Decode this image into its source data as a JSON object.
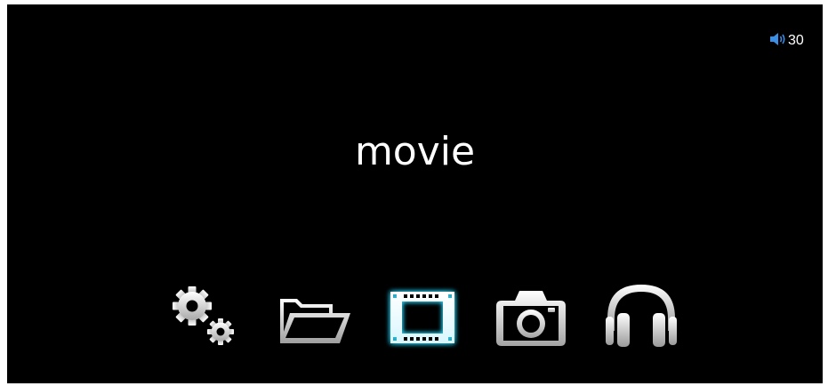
{
  "screen": {
    "title": "movie",
    "selected_item": "movie"
  },
  "status": {
    "volume_icon": "speaker-icon",
    "volume_value": "30"
  },
  "menu": {
    "items": [
      {
        "id": "settings",
        "icon": "gears-icon",
        "selected": false
      },
      {
        "id": "files",
        "icon": "folder-open-icon",
        "selected": false
      },
      {
        "id": "movie",
        "icon": "film-strip-icon",
        "selected": true
      },
      {
        "id": "photo",
        "icon": "camera-icon",
        "selected": false
      },
      {
        "id": "music",
        "icon": "headphones-icon",
        "selected": false
      }
    ]
  },
  "colors": {
    "background": "#000000",
    "text": "#ffffff",
    "icon_fill": "#e6e6e6",
    "selected_glow": "#29c6e8",
    "volume_icon": "#3a8ee6"
  }
}
